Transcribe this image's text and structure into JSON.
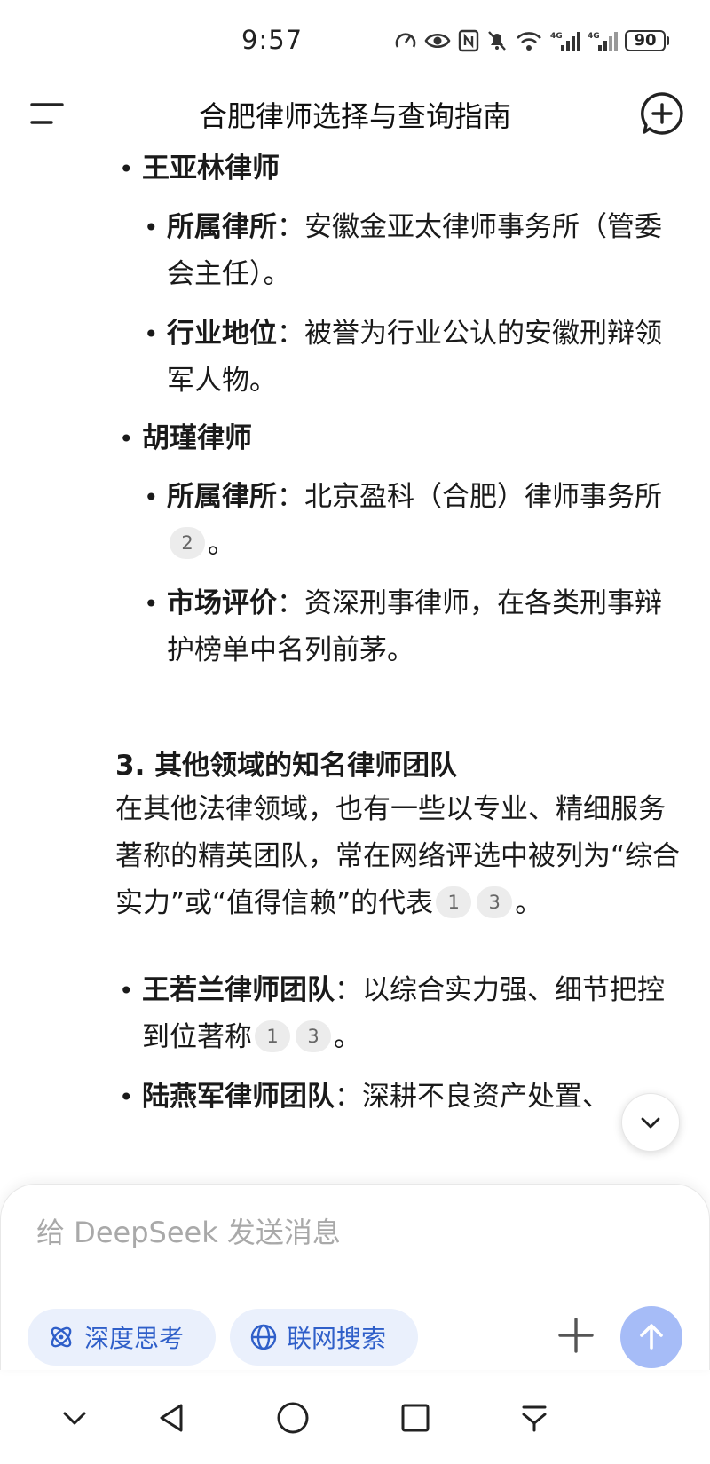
{
  "status_bar": {
    "time": "9:57",
    "battery": "90"
  },
  "header": {
    "title": "合肥律师选择与查询指南"
  },
  "content": {
    "items": [
      {
        "bold": "王亚林律师"
      },
      {
        "bold": "所属律所",
        "sep": "：",
        "text": "安徽金亚太律师事务所（管委会主任）。"
      },
      {
        "bold": "行业地位",
        "sep": "：",
        "text": "被誉为行业公认的安徽刑辩领军人物。"
      },
      {
        "bold": "胡瑾律师"
      },
      {
        "bold": "所属律所",
        "sep": "：",
        "text": "北京盈科（合肥）律师事务所",
        "cites": [
          "2"
        ],
        "tail": "。"
      },
      {
        "bold": "市场评价",
        "sep": "：",
        "text": "资深刑事律师，在各类刑事辩护榜单中名列前茅。"
      }
    ],
    "section": {
      "heading": "3. 其他领域的知名律师团队",
      "paragraph": "在其他法律领域，也有一些以专业、精细服务著称的精英团队，常在网络评选中被列为“综合实力”或“值得信赖”的代表",
      "cites": [
        "1",
        "3"
      ],
      "tail": "。"
    },
    "teams": [
      {
        "bold": "王若兰律师团队",
        "sep": "：",
        "text": "以综合实力强、细节把控到位著称",
        "cites": [
          "1",
          "3"
        ],
        "tail": "。"
      },
      {
        "bold": "陆燕军律师团队",
        "sep": "：",
        "text": "深耕不良资产处置、"
      }
    ]
  },
  "composer": {
    "placeholder": "给 DeepSeek 发送消息",
    "deep_think_label": "深度思考",
    "web_search_label": "联网搜索"
  },
  "colors": {
    "accent": "#2f5fc9",
    "chip_bg": "#eaf0fc",
    "send_disabled": "#a6bcf7"
  }
}
